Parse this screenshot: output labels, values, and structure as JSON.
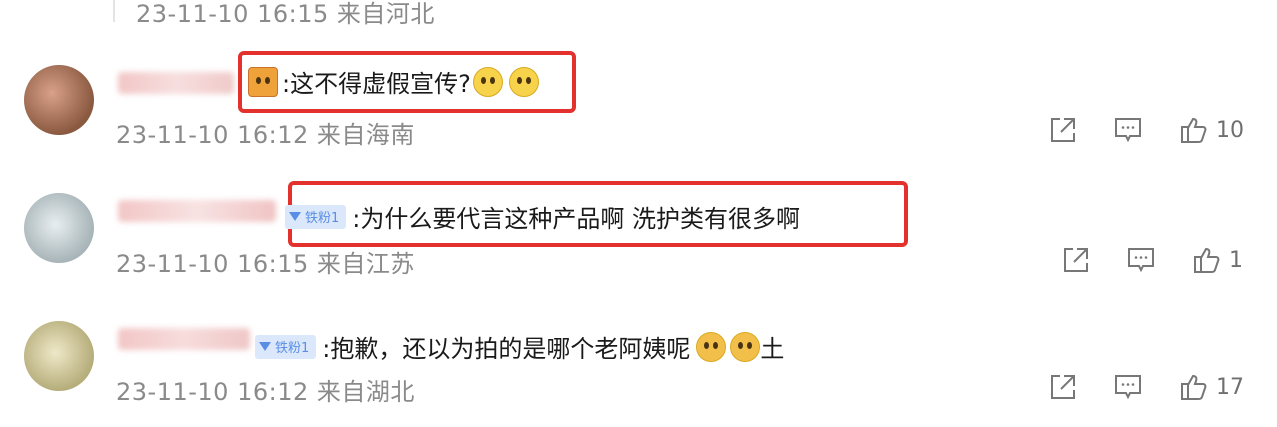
{
  "top_meta": "23-11-10 16:15 来自河北",
  "comments": [
    {
      "meta": "23-11-10 16:12 来自海南",
      "text": ":这不得虚假宣传?",
      "likes": "10",
      "badge": ""
    },
    {
      "meta": "23-11-10 16:15 来自江苏",
      "text": ":为什么要代言这种产品啊 洗护类有很多啊",
      "likes": "1",
      "badge": "铁粉1"
    },
    {
      "meta": "23-11-10 16:12 来自湖北",
      "text": ":抱歉，还以为拍的是哪个老阿姨呢",
      "suffix": "土",
      "likes": "17",
      "badge": "铁粉1"
    }
  ],
  "icons": {
    "share": "share-icon",
    "comment": "comment-icon",
    "like": "thumbs-up-icon"
  },
  "colors": {
    "highlight": "#e3312e",
    "meta": "#8a8a8a",
    "badge_bg": "#dbe8fb"
  }
}
